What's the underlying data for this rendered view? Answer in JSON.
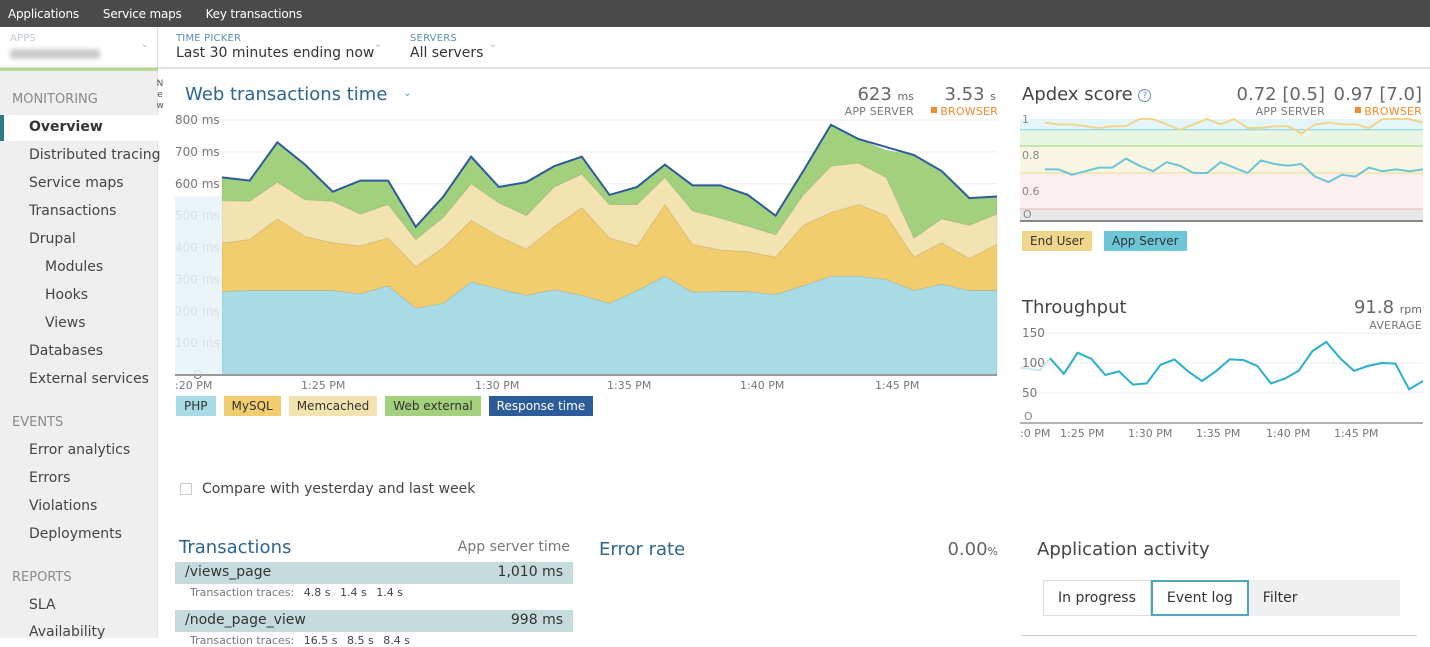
{
  "topnav": {
    "items": [
      "Applications",
      "Service maps",
      "Key transactions"
    ]
  },
  "pickers": {
    "apps": {
      "label": "APPS",
      "value": "[redacted]"
    },
    "time": {
      "label": "TIME PICKER",
      "value": "Last 30 minutes ending now"
    },
    "servers": {
      "label": "SERVERS",
      "value": "All servers"
    }
  },
  "sidebar": {
    "sections": [
      {
        "title": "MONITORING",
        "items": [
          {
            "label": "Overview",
            "active": true
          },
          {
            "label": "Distributed tracing",
            "badge": "New"
          },
          {
            "label": "Service maps"
          },
          {
            "label": "Transactions"
          },
          {
            "label": "Drupal"
          },
          {
            "label": "Modules",
            "sub": true
          },
          {
            "label": "Hooks",
            "sub": true
          },
          {
            "label": "Views",
            "sub": true
          },
          {
            "label": "Databases"
          },
          {
            "label": "External services"
          }
        ]
      },
      {
        "title": "EVENTS",
        "items": [
          {
            "label": "Error analytics"
          },
          {
            "label": "Errors"
          },
          {
            "label": "Violations"
          },
          {
            "label": "Deployments"
          }
        ]
      },
      {
        "title": "REPORTS",
        "items": [
          {
            "label": "SLA"
          },
          {
            "label": "Availability"
          }
        ]
      }
    ],
    "new_badge_letters": [
      "N",
      "e",
      "w"
    ]
  },
  "web_tx": {
    "title": "Web transactions time",
    "app_server_value": "623",
    "app_server_unit": "ms",
    "app_server_label": "APP SERVER",
    "browser_value": "3.53",
    "browser_unit": "s",
    "browser_label": "BROWSER"
  },
  "apdex": {
    "title": "Apdex score",
    "app_server_value": "0.72 [0.5]",
    "app_server_label": "APP SERVER",
    "browser_value": "0.97 [7.0]",
    "browser_label": "BROWSER"
  },
  "throughput": {
    "title": "Throughput",
    "value": "91.8",
    "unit": "rpm",
    "label": "AVERAGE"
  },
  "compare": {
    "label": "Compare with yesterday and last week",
    "checked": false
  },
  "transactions": {
    "title": "Transactions",
    "column": "App server time",
    "traces_label": "Transaction traces:",
    "rows": [
      {
        "name": "/views_page",
        "time": "1,010 ms",
        "traces": [
          "4.8 s",
          "1.4 s",
          "1.4 s"
        ]
      },
      {
        "name": "/node_page_view",
        "time": "998 ms",
        "traces": [
          "16.5 s",
          "8.5 s",
          "8.4 s"
        ]
      }
    ]
  },
  "error_rate": {
    "title": "Error rate",
    "value": "0.00",
    "unit": "%"
  },
  "activity": {
    "title": "Application activity",
    "tabs": [
      {
        "label": "In progress",
        "active": false
      },
      {
        "label": "Event log",
        "active": true
      },
      {
        "label": "Filter",
        "active": false
      }
    ]
  },
  "colors": {
    "php": "#a8dbe6",
    "mysql": "#f2cd6d",
    "memcached": "#f3e3b0",
    "web_external": "#a3d07c",
    "response_time": "#2b5b9a",
    "end_user": "#f0d68a",
    "app_server": "#6cc6d8",
    "accent": "#2e6490",
    "browser": "#f08a2a"
  },
  "chart_data": [
    {
      "type": "area",
      "title": "Web transactions time",
      "ylabel": "ms",
      "ylim": [
        0,
        800
      ],
      "yticks": [
        "0",
        "100 ms",
        "200 ms",
        "300 ms",
        "400 ms",
        "500 ms",
        "600 ms",
        "700 ms",
        "800 ms"
      ],
      "xticks": [
        ":20 PM",
        "1:25 PM",
        "1:30 PM",
        "1:35 PM",
        "1:40 PM",
        "1:45 PM"
      ],
      "legend": [
        "PHP",
        "MySQL",
        "Memcached",
        "Web external",
        "Response time"
      ],
      "stacked": true,
      "series": [
        {
          "name": "PHP",
          "values": [
            262,
            265,
            265,
            265,
            265,
            255,
            280,
            210,
            225,
            292,
            270,
            250,
            268,
            250,
            225,
            265,
            310,
            260,
            262,
            262,
            253,
            280,
            310,
            310,
            300,
            265,
            285,
            265,
            265
          ]
        },
        {
          "name": "MySQL",
          "values": [
            152,
            160,
            225,
            170,
            150,
            150,
            150,
            130,
            175,
            193,
            165,
            145,
            197,
            275,
            205,
            140,
            225,
            150,
            130,
            125,
            117,
            190,
            200,
            225,
            200,
            105,
            130,
            100,
            145
          ]
        },
        {
          "name": "Memcached",
          "values": [
            133,
            120,
            115,
            115,
            130,
            100,
            105,
            85,
            95,
            115,
            105,
            105,
            125,
            105,
            105,
            130,
            85,
            105,
            100,
            80,
            70,
            95,
            145,
            130,
            120,
            60,
            75,
            105,
            95
          ]
        },
        {
          "name": "Web external",
          "values": [
            73,
            65,
            125,
            110,
            30,
            105,
            75,
            40,
            65,
            85,
            50,
            105,
            65,
            55,
            30,
            55,
            40,
            80,
            103,
            98,
            60,
            75,
            130,
            75,
            85,
            260,
            150,
            85,
            55
          ]
        },
        {
          "name": "Response time",
          "values": [
            620,
            610,
            730,
            660,
            575,
            610,
            610,
            465,
            560,
            685,
            590,
            605,
            655,
            685,
            565,
            590,
            660,
            595,
            595,
            565,
            500,
            640,
            785,
            740,
            715,
            690,
            640,
            555,
            560
          ]
        }
      ]
    },
    {
      "type": "line",
      "title": "Apdex score",
      "ylim": [
        0.5,
        1
      ],
      "yticks": [
        "0",
        "0.6",
        "0.8",
        "1"
      ],
      "legend": [
        "End User",
        "App Server"
      ],
      "thresholds": [
        0.94,
        0.85,
        0.7,
        0.5
      ],
      "series": [
        {
          "name": "End User",
          "values": [
            0.98,
            0.97,
            0.97,
            0.96,
            0.95,
            0.96,
            0.96,
            1.0,
            1.0,
            0.97,
            0.94,
            0.97,
            1.0,
            0.97,
            1.0,
            0.95,
            0.95,
            0.96,
            0.96,
            0.92,
            0.97,
            0.98,
            0.97,
            0.97,
            0.95,
            1.0,
            1.0,
            1.0,
            0.98
          ]
        },
        {
          "name": "App Server",
          "values": [
            0.72,
            0.72,
            0.69,
            0.71,
            0.73,
            0.73,
            0.78,
            0.74,
            0.71,
            0.76,
            0.74,
            0.7,
            0.7,
            0.76,
            0.73,
            0.7,
            0.77,
            0.75,
            0.74,
            0.75,
            0.68,
            0.65,
            0.69,
            0.68,
            0.73,
            0.71,
            0.72,
            0.71,
            0.72
          ]
        }
      ]
    },
    {
      "type": "line",
      "title": "Throughput",
      "ylabel": "rpm",
      "ylim": [
        0,
        150
      ],
      "yticks": [
        "0",
        "50",
        "100",
        "150"
      ],
      "xticks": [
        ":0 PM",
        "1:25 PM",
        "1:30 PM",
        "1:35 PM",
        "1:40 PM",
        "1:45 PM"
      ],
      "series": [
        {
          "name": "Throughput",
          "values": [
            108,
            82,
            117,
            107,
            80,
            86,
            64,
            66,
            97,
            106,
            86,
            70,
            86,
            106,
            105,
            95,
            66,
            74,
            87,
            120,
            135,
            108,
            87,
            95,
            100,
            99,
            56,
            70
          ]
        }
      ]
    }
  ]
}
